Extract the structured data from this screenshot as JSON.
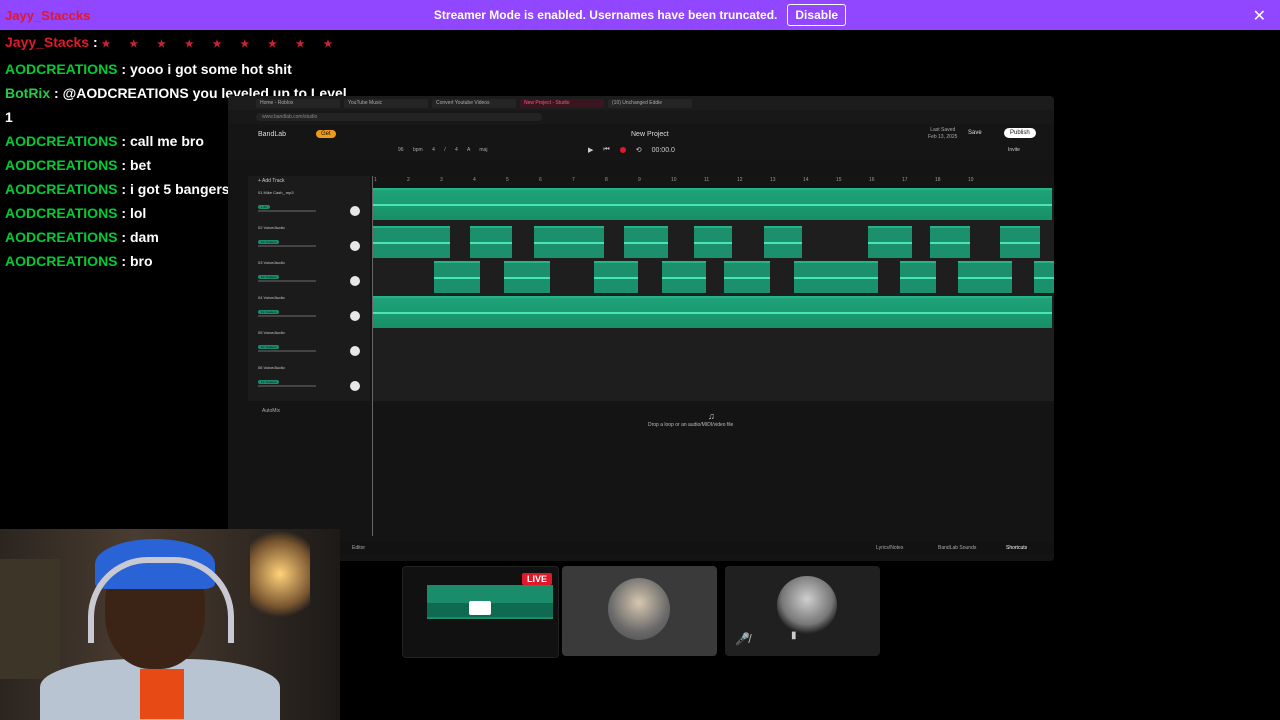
{
  "banner": {
    "chat_user": "Jayy_Staccks",
    "text": "Streamer Mode is enabled. Usernames have been truncated.",
    "disable_label": "Disable",
    "close_icon": "✕"
  },
  "chat": [
    {
      "user": "Jayy_Stacks",
      "sep": " : ",
      "message": "",
      "emotes": "★ ★ ★ ★ ★ ★ ★ ★ ★",
      "color": "red"
    },
    {
      "user": "AODCREATIONS",
      "sep": " : ",
      "message": "yooo i got some hot shit",
      "color": "green"
    },
    {
      "user": "BotRix",
      "sep": " : ",
      "message": "@AODCREATIONS you leveled up to Level",
      "color": "bot"
    },
    {
      "user": "",
      "sep": "",
      "message": "1",
      "color": "plain"
    },
    {
      "user": "AODCREATIONS",
      "sep": " : ",
      "message": "call me bro",
      "color": "green"
    },
    {
      "user": "AODCREATIONS",
      "sep": " : ",
      "message": "bet",
      "color": "green"
    },
    {
      "user": "AODCREATIONS",
      "sep": " : ",
      "message": "i got 5 bangers for u",
      "color": "green"
    },
    {
      "user": "AODCREATIONS",
      "sep": " : ",
      "message": "lol",
      "color": "green"
    },
    {
      "user": "AODCREATIONS",
      "sep": " : ",
      "message": "dam",
      "color": "green"
    },
    {
      "user": "AODCREATIONS",
      "sep": " : ",
      "message": "bro",
      "color": "green"
    }
  ],
  "browser": {
    "tabs": [
      "Home - Roblox",
      "YouTube Music",
      "Convert Youtube Videos",
      "New Project - Studio",
      "(10) Unchanged Eddie"
    ],
    "active_tab": 3,
    "url": "www.bandlab.com/studio"
  },
  "daw": {
    "brand": "BandLab",
    "get_label": "Get",
    "project_title": "New Project",
    "tempo": "96 bpm",
    "time_sig": "4 / 4",
    "key": "A maj",
    "time": "00:00.0",
    "last_saved": "Last Saved",
    "last_saved_date": "Feb 13, 2025",
    "save_label": "Save",
    "publish_label": "Publish",
    "invite_label": "Invite",
    "add_track": "+ Add Track",
    "ruler": [
      "1",
      "2",
      "3",
      "4",
      "5",
      "6",
      "7",
      "8",
      "9",
      "10",
      "11",
      "12",
      "13",
      "14",
      "15",
      "16",
      "17",
      "18",
      "19"
    ],
    "tracks": [
      {
        "name": "01  Mike Cash_.mp3",
        "fx": "+ Fx"
      },
      {
        "name": "02  Voice/Audio",
        "fx": "Fx: Custom"
      },
      {
        "name": "03  Voice/Audio",
        "fx": "Fx: Custom"
      },
      {
        "name": "04  Voice/Audio",
        "fx": "Fx: Custom"
      },
      {
        "name": "05  Voice/Audio",
        "fx": "Fx: Custom"
      },
      {
        "name": "06  Voice/Audio",
        "fx": "Fx: Custom"
      }
    ],
    "automix": "AutoMix",
    "drop_hint": "Drop a loop or an audio/MIDI/video file",
    "bottom": {
      "editor": "Editor",
      "lyrics": "Lyrics/Notes",
      "sounds": "BandLab Sounds",
      "shortcuts": "Shortcuts"
    }
  },
  "thumbnails": {
    "live_badge": "LIVE"
  },
  "colors": {
    "banner": "#9146ff",
    "user_green": "#00cc33",
    "user_red": "#e0192a",
    "clip": "#1c8f6d"
  }
}
